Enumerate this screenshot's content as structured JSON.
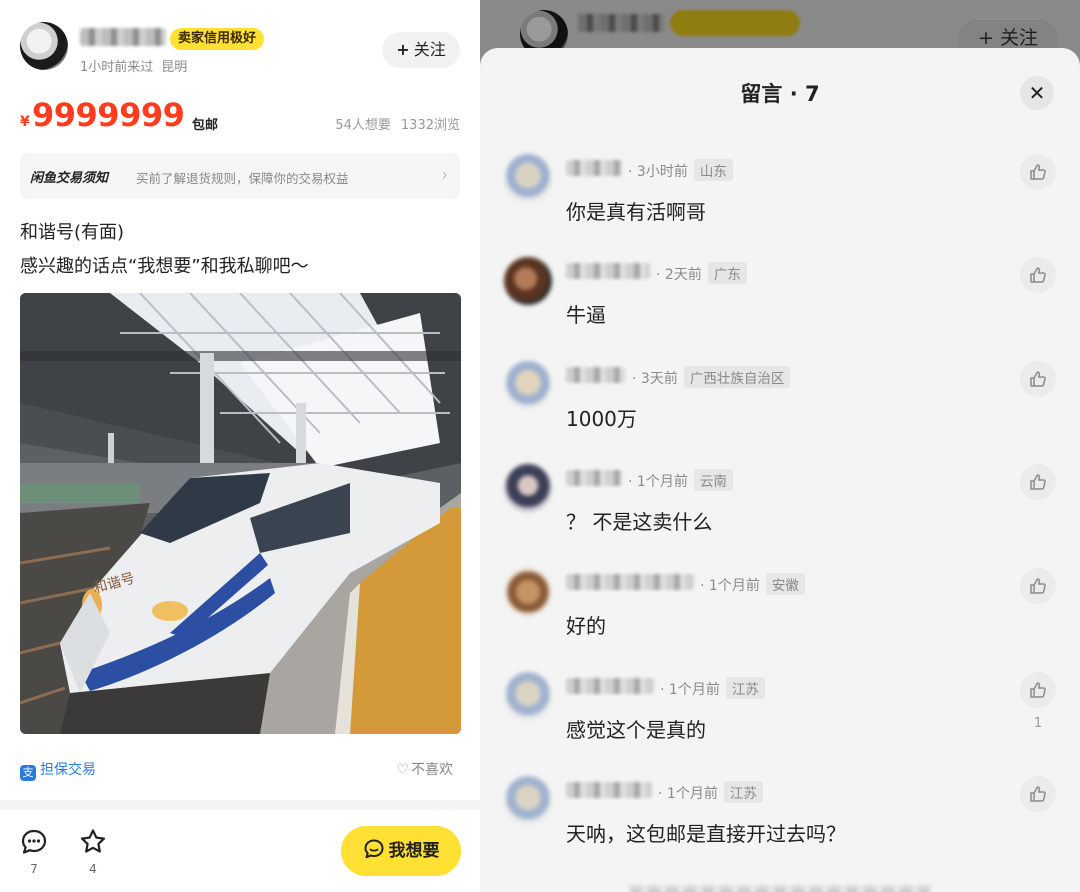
{
  "listing": {
    "seller": {
      "badge": "卖家信用极好",
      "last_seen": "1小时前来过",
      "city": "昆明",
      "follow_label": "关注"
    },
    "price": {
      "currency": "¥",
      "amount": "9999999",
      "shipping": "包邮",
      "wants": "54人想要",
      "views": "1332浏览"
    },
    "notice": {
      "title": "闲鱼交易须知",
      "text": "买前了解退货规则，保障你的交易权益"
    },
    "description": {
      "line1": "和谐号(有面)",
      "line2": "感兴趣的话点“我想要”和我私聊吧～"
    },
    "guarantee_label": "担保交易",
    "dislike_label": "不喜欢",
    "bottom_bar": {
      "comment_count": "7",
      "favorite_count": "4",
      "want_label": "我想要"
    }
  },
  "background_header": {
    "follow_label": "关注"
  },
  "comments_sheet": {
    "title": "留言 · 7",
    "close_symbol": "✕",
    "comments": [
      {
        "time": "3小时前",
        "location": "山东",
        "text": "你是真有活啊哥",
        "likes": ""
      },
      {
        "time": "2天前",
        "location": "广东",
        "text": "牛逼",
        "likes": ""
      },
      {
        "time": "3天前",
        "location": "广西壮族自治区",
        "text": "1000万",
        "likes": ""
      },
      {
        "time": "1个月前",
        "location": "云南",
        "text": "？ 不是这卖什么",
        "likes": ""
      },
      {
        "time": "1个月前",
        "location": "安徽",
        "text": "好的",
        "likes": ""
      },
      {
        "time": "1个月前",
        "location": "江苏",
        "text": "感觉这个是真的",
        "likes": "1"
      },
      {
        "time": "1个月前",
        "location": "江苏",
        "text": "天呐，这包邮是直接开过去吗？",
        "likes": ""
      }
    ]
  },
  "colors": {
    "accent_yellow": "#ffe033",
    "price_red": "#ff3d1e",
    "link_blue": "#2a7bd8"
  }
}
